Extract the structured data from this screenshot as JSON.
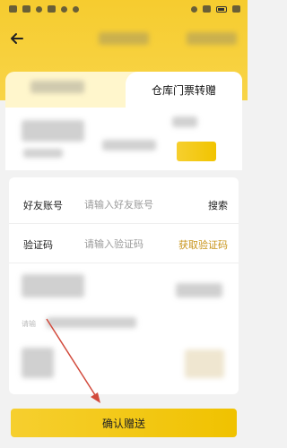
{
  "tab": {
    "active_label": "仓库门票转赠"
  },
  "form": {
    "friend_label": "好友账号",
    "friend_placeholder": "请输入好友账号",
    "search_label": "搜索",
    "code_label": "验证码",
    "code_placeholder": "请输入验证码",
    "get_code_label": "获取验证码",
    "hint_text": "请输"
  },
  "footer": {
    "confirm_label": "确认赠送"
  },
  "colors": {
    "accent": "#f6cc2f",
    "orange_text": "#c8941a",
    "annotation_arrow": "#d24a3c"
  }
}
